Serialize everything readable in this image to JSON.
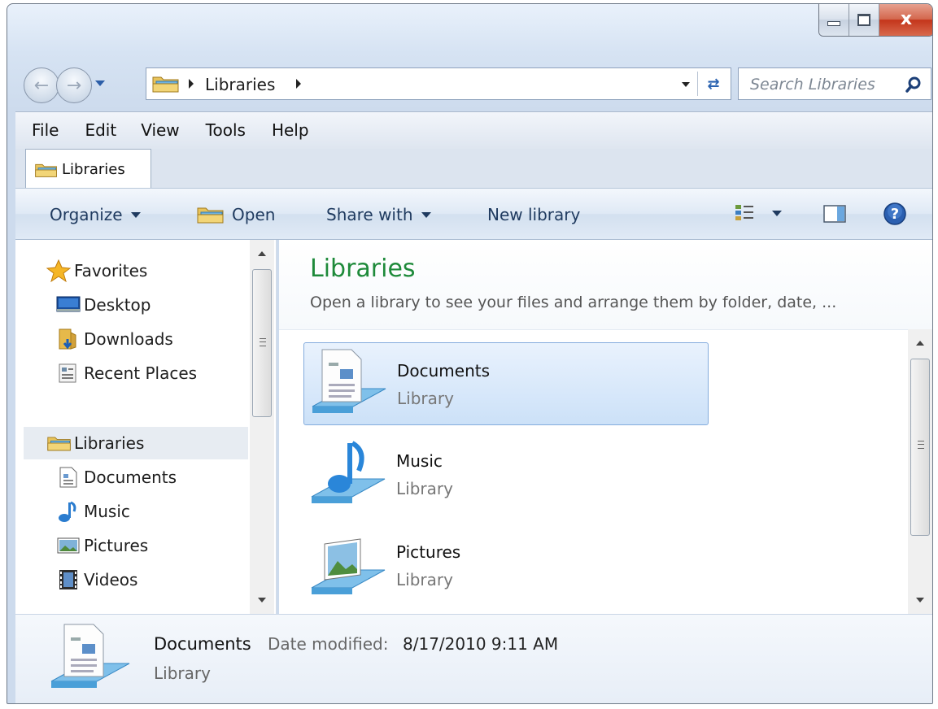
{
  "window": {
    "title": "Libraries"
  },
  "address": {
    "crumb": "Libraries"
  },
  "search": {
    "placeholder": "Search Libraries"
  },
  "menu": {
    "items": [
      "File",
      "Edit",
      "View",
      "Tools",
      "Help"
    ]
  },
  "tab": {
    "label": "Libraries"
  },
  "toolbar": {
    "organize": "Organize",
    "open": "Open",
    "share_with": "Share with",
    "new_library": "New library"
  },
  "nav": {
    "favorites": "Favorites",
    "desktop": "Desktop",
    "downloads": "Downloads",
    "recent_places": "Recent Places",
    "libraries": "Libraries",
    "documents": "Documents",
    "music": "Music",
    "pictures": "Pictures",
    "videos": "Videos"
  },
  "content": {
    "title": "Libraries",
    "subtitle": "Open a library to see your files and arrange them by folder, date, ...",
    "items": [
      {
        "name": "Documents",
        "type": "Library",
        "selected": true
      },
      {
        "name": "Music",
        "type": "Library",
        "selected": false
      },
      {
        "name": "Pictures",
        "type": "Library",
        "selected": false
      }
    ]
  },
  "details": {
    "name": "Documents",
    "date_label": "Date modified:",
    "date_value": "8/17/2010 9:11 AM",
    "type": "Library"
  },
  "colors": {
    "title_green": "#1e8a3a",
    "selection_border": "#84acdd",
    "close_red": "#c4341a"
  }
}
